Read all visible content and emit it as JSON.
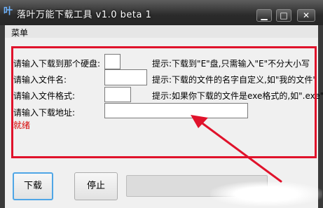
{
  "window": {
    "title": "落叶万能下载工具 v1.0 beta 1",
    "app_icon_glyph": "叶",
    "minimize_glyph": "▁",
    "maximize_glyph": "□",
    "close_glyph": "✕"
  },
  "menu": {
    "items": [
      {
        "label": "菜单"
      }
    ]
  },
  "form": {
    "fields": [
      {
        "label": "请输入下载到那个硬盘:",
        "value": "",
        "tip": "提示:下载到\"E\"盘,只需输入\"E\"不分大小写"
      },
      {
        "label": "请输入文件名:",
        "value": "",
        "tip": "提示:下载的文件的名字自定义,如\"我的文件\""
      },
      {
        "label": "请输入文件格式:",
        "value": "",
        "tip": "提示:如果你下载的文件是exe格式的,如\".exe\""
      },
      {
        "label": "请输入下载地址:",
        "value": ""
      }
    ],
    "status": "就绪",
    "status_color": "#d40000"
  },
  "buttons": {
    "download": "下载",
    "stop": "停止"
  },
  "progress": {
    "fraction": 0
  },
  "annotation": {
    "box_color": "#e0122b",
    "arrow_color": "#e0122b"
  }
}
